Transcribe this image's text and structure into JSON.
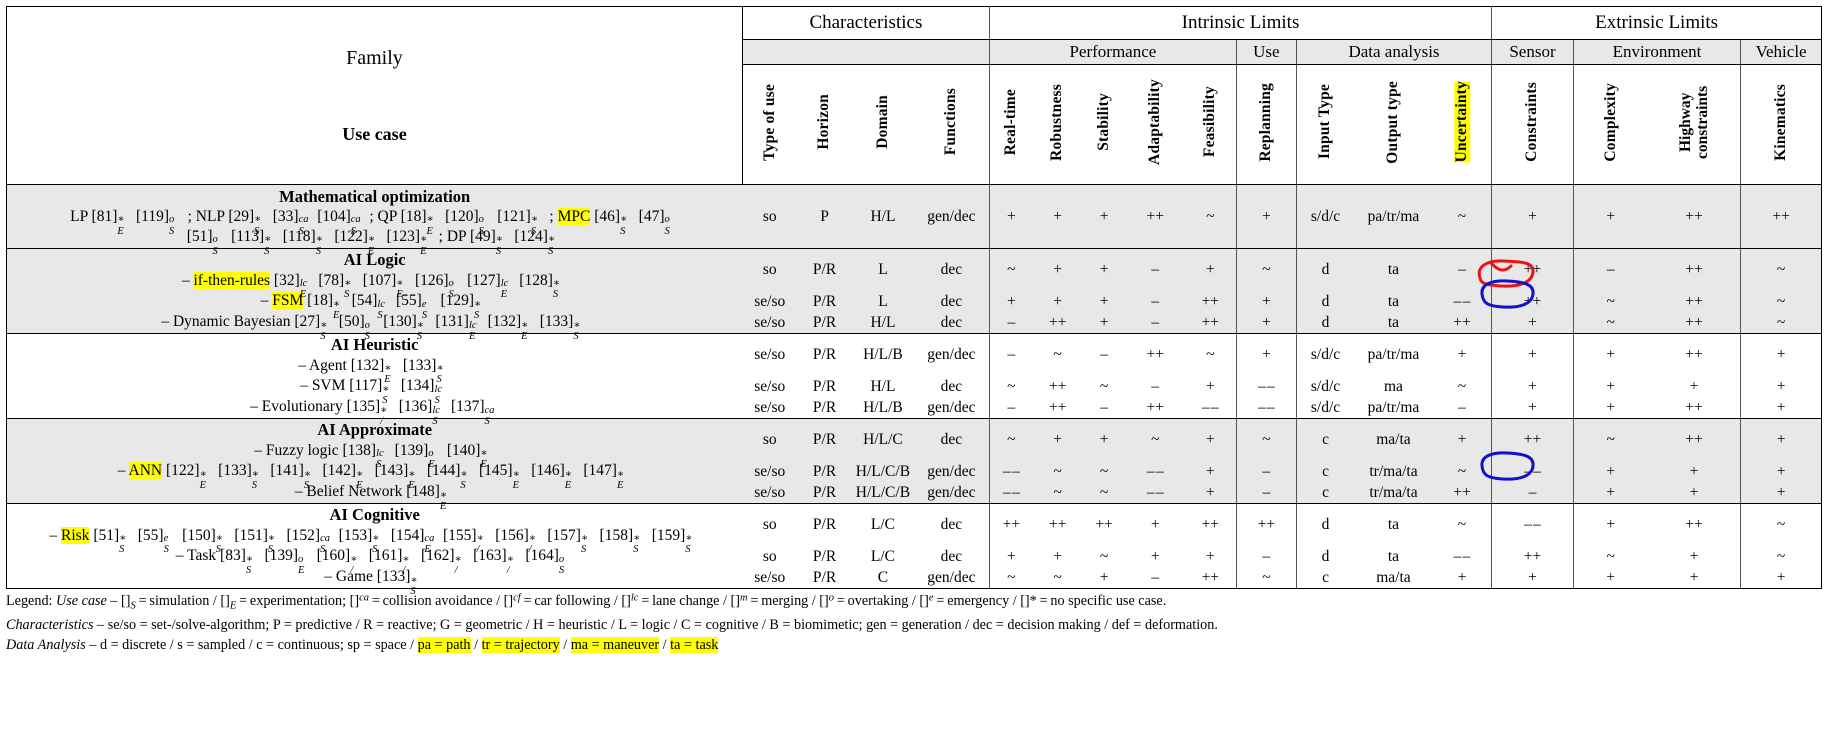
{
  "header": {
    "family": "Family",
    "use_case": "Use case",
    "groups": [
      {
        "label": "Characteristics",
        "span": 4
      },
      {
        "label": "Intrinsic Limits",
        "span": 9
      },
      {
        "label": "Extrinsic Limits",
        "span": 4
      }
    ],
    "subgroups": [
      {
        "label": "Performance",
        "span": 5
      },
      {
        "label": "Use",
        "span": 1
      },
      {
        "label": "Data analysis",
        "span": 3
      },
      {
        "label": "Sensor",
        "span": 1
      },
      {
        "label": "Environment",
        "span": 2
      },
      {
        "label": "Vehicle",
        "span": 1
      }
    ],
    "columns": [
      {
        "label": "Type of use",
        "highlight": false
      },
      {
        "label": "Horizon",
        "highlight": false
      },
      {
        "label": "Domain",
        "highlight": false
      },
      {
        "label": "Functions",
        "highlight": false
      },
      {
        "label": "Real-time",
        "highlight": false
      },
      {
        "label": "Robustness",
        "highlight": false
      },
      {
        "label": "Stability",
        "highlight": false
      },
      {
        "label": "Adaptability",
        "highlight": false
      },
      {
        "label": "Feasibility",
        "highlight": false
      },
      {
        "label": "Replanning",
        "highlight": false
      },
      {
        "label": "Input Type",
        "highlight": false
      },
      {
        "label": "Output type",
        "highlight": false
      },
      {
        "label": "Uncertainty",
        "highlight": true
      },
      {
        "label": "Constraints",
        "highlight": false
      },
      {
        "label": "Complexity",
        "highlight": false
      },
      {
        "label": "Highway constraints",
        "highlight": false
      },
      {
        "label": "Kinematics",
        "highlight": false
      }
    ]
  },
  "sections": [
    {
      "title": "Mathematical optimization",
      "shaded": true,
      "rows": [
        {
          "refs_lines": [
            "LP [81]*E [119]oS ; NLP [29]*S [33]caS [104]caS ; QP [18]*E [120]oS [121]*S ; MPC [46]*S [47]oS",
            "[51]oS [113]*S [118]*S [122]*E [123]*E ; DP [49]*S [124]*S"
          ],
          "values": [
            "so",
            "P",
            "H/L",
            "gen/dec",
            "+",
            "+",
            "+",
            "++",
            "~",
            "+",
            "s/d/c",
            "pa/tr/ma",
            "~",
            "+",
            "+",
            "++",
            "++"
          ]
        }
      ]
    },
    {
      "title": "AI Logic",
      "shaded": true,
      "rows": [
        {
          "refs_lines": [
            "– if-then-rules [32]lcE [78]*S [107]*E [126]oS [127]lcE [128]*S"
          ],
          "values": [
            "so",
            "P/R",
            "L",
            "dec",
            "~",
            "+",
            "+",
            "–",
            "+",
            "~",
            "d",
            "ta",
            "–",
            "++",
            "–",
            "++",
            "~"
          ]
        },
        {
          "refs_lines": [
            "– FSM [18]*E [54]lcS [55]eS [129]*S"
          ],
          "values": [
            "se/so",
            "P/R",
            "L",
            "dec",
            "+",
            "+",
            "+",
            "–",
            "++",
            "+",
            "d",
            "ta",
            "– –",
            "++",
            "~",
            "++",
            "~"
          ]
        },
        {
          "refs_lines": [
            "– Dynamic Bayesian [27]*S [50]oS [130]*S [131]lcE [132]*E [133]*S"
          ],
          "values": [
            "se/so",
            "P/R",
            "H/L",
            "dec",
            "–",
            "++",
            "+",
            "–",
            "++",
            "+",
            "d",
            "ta",
            "++",
            "+",
            "~",
            "++",
            "~"
          ]
        }
      ]
    },
    {
      "title": "AI Heuristic",
      "shaded": false,
      "rows": [
        {
          "refs_lines": [
            "– Agent [132]*E [133]*S"
          ],
          "values": [
            "se/so",
            "P/R",
            "H/L/B",
            "gen/dec",
            "–",
            "~",
            "–",
            "++",
            "~",
            "+",
            "s/d/c",
            "pa/tr/ma",
            "+",
            "+",
            "+",
            "++",
            "+"
          ]
        },
        {
          "refs_lines": [
            "– SVM [117]*S [134]lcS"
          ],
          "values": [
            "se/so",
            "P/R",
            "H/L",
            "dec",
            "~",
            "++",
            "~",
            "–",
            "+",
            "– –",
            "s/d/c",
            "ma",
            "~",
            "+",
            "+",
            "+",
            "+"
          ]
        },
        {
          "refs_lines": [
            "– Evolutionary [135]*/ [136]lcS [137]caS"
          ],
          "values": [
            "se/so",
            "P/R",
            "H/L/B",
            "gen/dec",
            "–",
            "++",
            "–",
            "++",
            "– –",
            "– –",
            "s/d/c",
            "pa/tr/ma",
            "–",
            "+",
            "+",
            "++",
            "+"
          ]
        }
      ]
    },
    {
      "title": "AI Approximate",
      "shaded": true,
      "rows": [
        {
          "refs_lines": [
            "– Fuzzy logic [138]lcS [139]oE [140]*E"
          ],
          "values": [
            "so",
            "P/R",
            "H/L/C",
            "dec",
            "~",
            "+",
            "+",
            "~",
            "+",
            "~",
            "c",
            "ma/ta",
            "+",
            "++",
            "~",
            "++",
            "+"
          ]
        },
        {
          "refs_lines": [
            "– ANN [122]*E [133]*S [141]*S [142]*E [143]*E [144]*S [145]*E [146]*E [147]*E"
          ],
          "values": [
            "se/so",
            "P/R",
            "H/L/C/B",
            "gen/dec",
            "– –",
            "~",
            "~",
            "– –",
            "+",
            "–",
            "c",
            "tr/ma/ta",
            "~",
            "– –",
            "+",
            "+",
            "+"
          ]
        },
        {
          "refs_lines": [
            "– Belief Network [148]*E"
          ],
          "values": [
            "se/so",
            "P/R",
            "H/L/C/B",
            "gen/dec",
            "– –",
            "~",
            "~",
            "– –",
            "+",
            "–",
            "c",
            "tr/ma/ta",
            "++",
            "–",
            "+",
            "+",
            "+"
          ]
        }
      ]
    },
    {
      "title": "AI Cognitive",
      "shaded": false,
      "rows": [
        {
          "refs_lines": [
            "– Risk [51]*S [55]eS [150]*S [151]*S [152]caS [153]*S [154]caE [155]*/ [156]*/ [157]*S [158]*S [159]*S"
          ],
          "values": [
            "so",
            "P/R",
            "L/C",
            "dec",
            "++",
            "++",
            "++",
            "+",
            "++",
            "++",
            "d",
            "ta",
            "~",
            "– –",
            "+",
            "++",
            "~"
          ]
        },
        {
          "refs_lines": [
            "– Task [83]*S [139]oE [160]*/ [161]*/ [162]*/ [163]*/ [164]oS"
          ],
          "values": [
            "so",
            "P/R",
            "L/C",
            "dec",
            "+",
            "+",
            "~",
            "+",
            "+",
            "–",
            "d",
            "ta",
            "– –",
            "++",
            "~",
            "+",
            "~"
          ]
        },
        {
          "refs_lines": [
            "– Game [133]*S"
          ],
          "values": [
            "se/so",
            "P/R",
            "C",
            "gen/dec",
            "~",
            "~",
            "+",
            "–",
            "++",
            "~",
            "c",
            "ma/ta",
            "+",
            "+",
            "+",
            "+",
            "+"
          ]
        }
      ]
    }
  ],
  "legend": {
    "line1_label": "Legend:",
    "line1_title": "Use case",
    "line1_text": "– []S = simulation / []E = experimentation; []ca = collision avoidance / []cf = car following / []lc = lane change / []m = merging / []o = overtaking / []e = emergency / []* = no specific use case.",
    "line2_title": "Characteristics",
    "line2_text": "– se/so = set-/solve-algorithm; P = predictive / R = reactive; G = geometric / H = heuristic / L = logic / C = cognitive / B = biomimetic; gen = generation / dec = decision making / def = deformation.",
    "line3_title": "Data Analysis",
    "line3_text": "– d = discrete / s = sampled / c = continuous; sp = space / ",
    "line3_hl": [
      "pa = path",
      "tr = trajectory",
      "ma = maneuver",
      "ta = task"
    ]
  },
  "annotations": {
    "highlight_color": "#ffff00",
    "red_circle_color": "#ee1111",
    "blue_circle_color": "#1111cc",
    "red_circle_target": "FSM uncertainty value",
    "blue_circle_targets": [
      "Dynamic Bayesian uncertainty value",
      "Belief Network uncertainty value"
    ]
  },
  "highlighted_terms": [
    "MPC",
    "if-then-rules",
    "FSM",
    "ANN",
    "Risk",
    "Uncertainty",
    "pa = path",
    "tr = trajectory",
    "ma = maneuver",
    "ta = task"
  ]
}
